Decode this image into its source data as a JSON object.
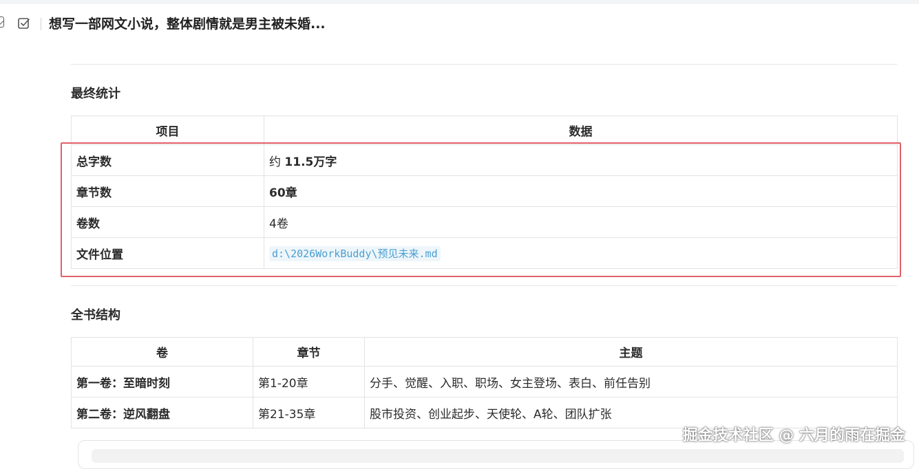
{
  "header": {
    "title": "想写一部网文小说，整体剧情就是男主被未婚..."
  },
  "stats": {
    "title": "最终统计",
    "columns": [
      "项目",
      "数据"
    ],
    "rows": [
      {
        "key": "总字数",
        "value_prefix": "约 ",
        "value_strong": "11.5万字"
      },
      {
        "key": "章节数",
        "value_strong": "60章"
      },
      {
        "key": "卷数",
        "value": "4卷"
      },
      {
        "key": "文件位置",
        "value_code": "d:\\2026WorkBuddy\\预见未来.md"
      }
    ]
  },
  "structure": {
    "title": "全书结构",
    "columns": [
      "卷",
      "章节",
      "主题"
    ],
    "rows": [
      {
        "volume": "第一卷：至暗时刻",
        "chapters": "第1-20章",
        "theme": "分手、觉醒、入职、职场、女主登场、表白、前任告别"
      },
      {
        "volume": "第二卷：逆风翻盘",
        "chapters": "第21-35章",
        "theme": "股市投资、创业起步、天使轮、A轮、团队扩张"
      }
    ]
  },
  "watermark": "掘金技术社区 @ 六月的雨在掘金",
  "colors": {
    "highlight": "#e06068",
    "code_text": "#4a9fd1"
  }
}
